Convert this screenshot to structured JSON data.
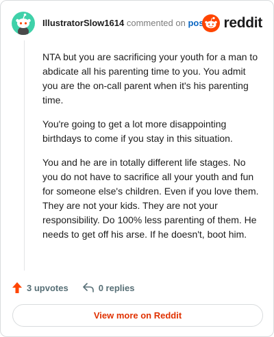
{
  "header": {
    "username": "IllustratorSlow1614",
    "commented_on": "commented on",
    "post_link": "post",
    "brand": "reddit"
  },
  "comment": {
    "paragraphs": [
      "NTA but you are sacrificing your youth for a man to abdicate all his parenting time to you. You admit you are the on-call parent when it's his parenting time.",
      "You're going to get a lot more disappointing birthdays to come if you stay in this situation.",
      "You and he are in totally different life stages. No you do not have to sacrifice all your youth and fun for someone else's children. Even if you love them. They are not your kids. They are not your responsibility. Do 100% less parenting of them. He needs to get off his arse. If he doesn't, boot him."
    ]
  },
  "actions": {
    "upvotes": "3 upvotes",
    "replies": "0 replies"
  },
  "footer": {
    "view_more": "View more on Reddit"
  },
  "colors": {
    "avatar_bg": "#3fd1a9",
    "brand_orange": "#ff4500",
    "link_blue": "#0a66c2",
    "view_more_text": "#e03100"
  }
}
